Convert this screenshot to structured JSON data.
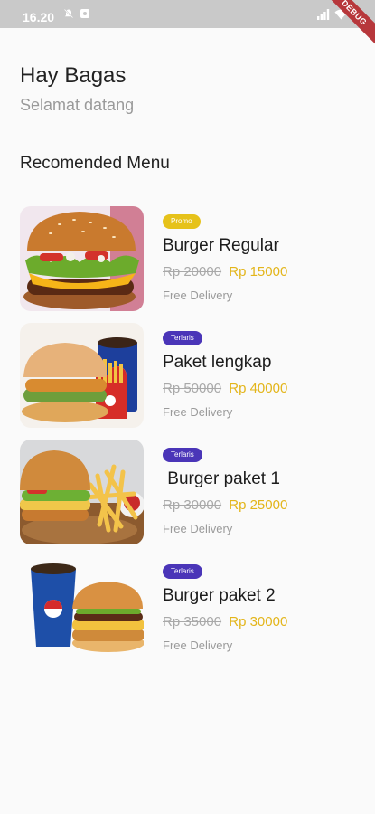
{
  "status_bar": {
    "time": "16.20",
    "left_icons": [
      "mute-bell-icon",
      "notification-square-icon"
    ],
    "right_icons": [
      "signal-icon",
      "wifi-icon",
      "battery-icon"
    ]
  },
  "debug_banner": "DEBUG",
  "header": {
    "greeting": "Hay Bagas",
    "subtitle": "Selamat datang"
  },
  "section_title": "Recomended Menu",
  "colors": {
    "promo_badge": "#e6c21a",
    "terlaris_badge": "#4a35b8",
    "discount_price": "#e3b51a",
    "old_price": "#a9a9a9"
  },
  "menu": [
    {
      "badge": "Promo",
      "badge_type": "promo",
      "name": "Burger Regular",
      "old_price": "Rp 20000",
      "new_price": "Rp 15000",
      "delivery": "Free Delivery",
      "image": "burger-regular-image"
    },
    {
      "badge": "Terlaris",
      "badge_type": "terlaris",
      "name": "Paket lengkap",
      "old_price": "Rp 50000",
      "new_price": "Rp 40000",
      "delivery": "Free Delivery",
      "image": "paket-lengkap-image"
    },
    {
      "badge": "Terlaris",
      "badge_type": "terlaris",
      "name": " Burger paket 1",
      "old_price": "Rp 30000",
      "new_price": "Rp 25000",
      "delivery": "Free Delivery",
      "image": "burger-paket-1-image"
    },
    {
      "badge": "Terlaris",
      "badge_type": "terlaris",
      "name": "Burger paket 2",
      "old_price": "Rp 35000",
      "new_price": "Rp 30000",
      "delivery": "Free Delivery",
      "image": "burger-paket-2-image"
    }
  ]
}
